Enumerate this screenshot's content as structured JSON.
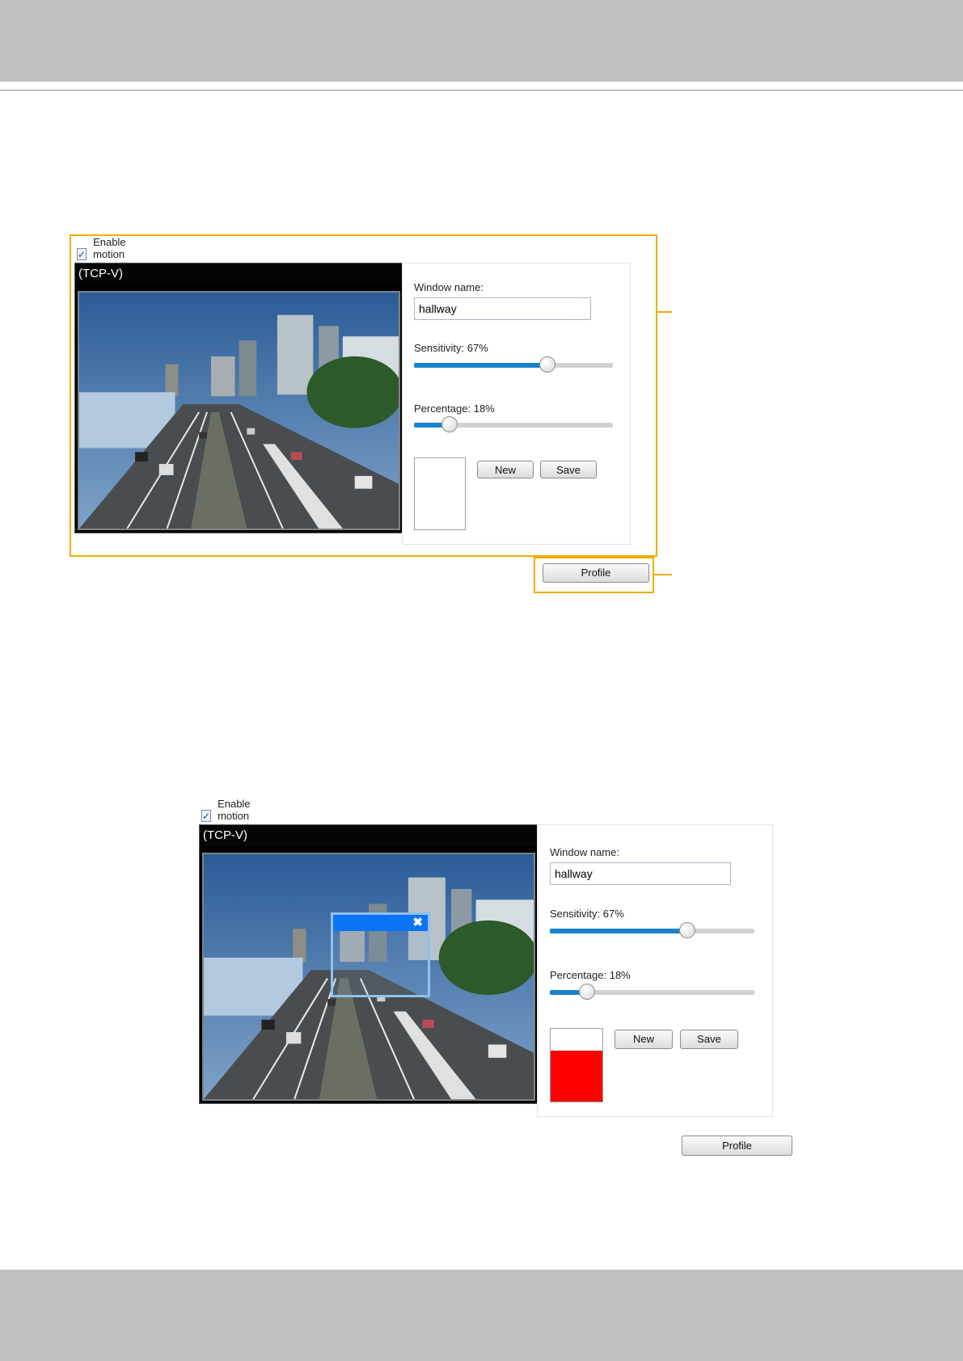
{
  "panels": [
    {
      "enable_label": "Enable motion detection",
      "enable_checked": true,
      "video_title": "(TCP-V)",
      "window_name_label": "Window name:",
      "window_name_value": "hallway",
      "sensitivity_label": "Sensitivity: 67%",
      "sensitivity_value": 0.67,
      "percentage_label": "Percentage: 18%",
      "percentage_value": 0.18,
      "gauge_level": 0,
      "new_label": "New",
      "save_label": "Save",
      "profile_label": "Profile"
    },
    {
      "enable_label": "Enable motion detection",
      "enable_checked": true,
      "video_title": "(TCP-V)",
      "window_name_label": "Window name:",
      "window_name_value": "hallway",
      "sensitivity_label": "Sensitivity: 67%",
      "sensitivity_value": 0.67,
      "percentage_label": "Percentage: 18%",
      "percentage_value": 0.18,
      "gauge_level": 0.7,
      "new_label": "New",
      "save_label": "Save",
      "profile_label": "Profile"
    }
  ],
  "colors": {
    "callout": "#f0ad00",
    "slider_fill": "#1a83cc",
    "gauge_fill": "#ff0000",
    "motion_window_title": "#0b73f5"
  },
  "icons": [
    "checkmark-icon",
    "close-icon"
  ]
}
